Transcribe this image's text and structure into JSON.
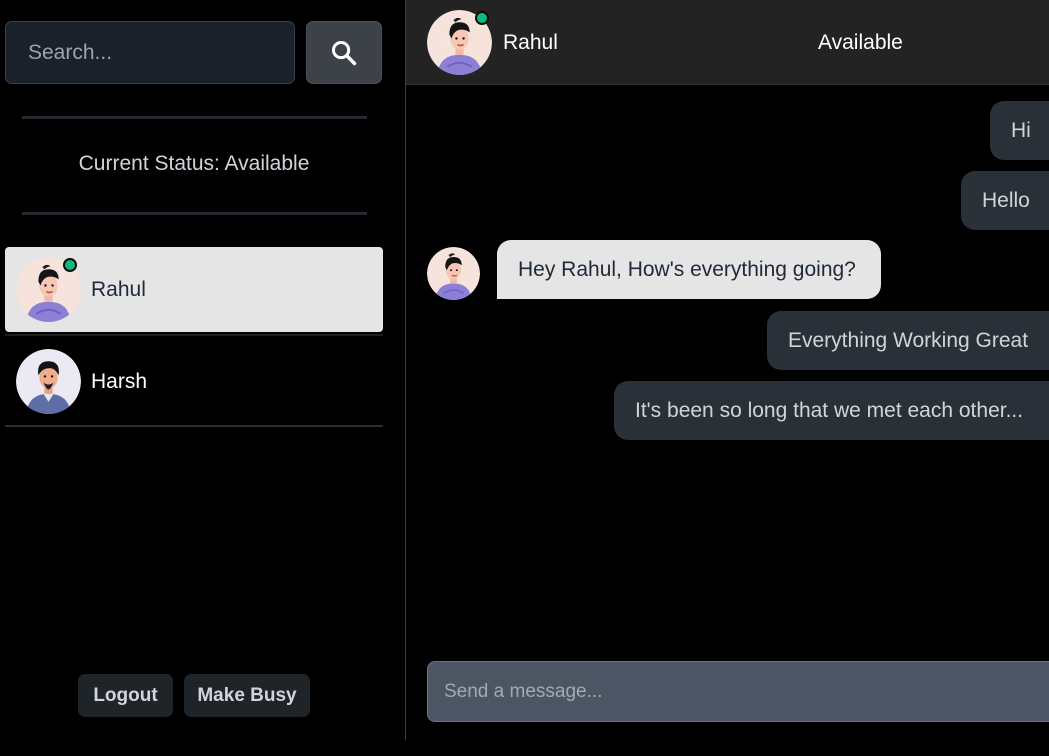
{
  "sidebar": {
    "search_placeholder": "Search...",
    "status_text": "Current Status: Available",
    "contacts": [
      {
        "name": "Rahul",
        "online": true,
        "active": true
      },
      {
        "name": "Harsh",
        "online": false,
        "active": false
      }
    ],
    "logout_label": "Logout",
    "make_busy_label": "Make Busy"
  },
  "chat": {
    "peer_name": "Rahul",
    "peer_status": "Available",
    "messages": [
      {
        "direction": "out",
        "text": "Hi"
      },
      {
        "direction": "out",
        "text": "Hello"
      },
      {
        "direction": "in",
        "text": "Hey Rahul, How's everything going?"
      },
      {
        "direction": "out",
        "text": "Everything Working Great"
      },
      {
        "direction": "out",
        "text": "It's been so long that we met each other..."
      }
    ],
    "composer_placeholder": "Send a message..."
  },
  "icons": {
    "search_button_icon": "search-icon",
    "online_indicator": "online-dot-icon"
  },
  "colors": {
    "online": "#10b981",
    "active_contact_bg": "#e5e5e5",
    "outgoing_bubble_bg": "#2a3038",
    "incoming_bubble_bg": "#e5e5e5"
  }
}
